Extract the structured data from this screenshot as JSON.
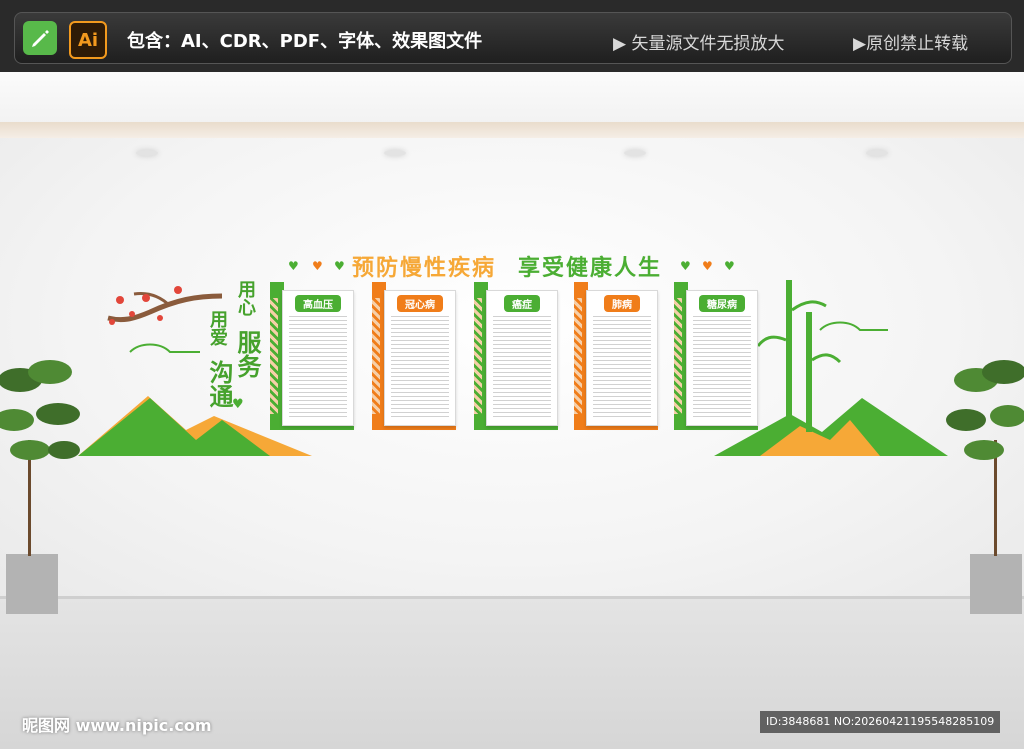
{
  "header": {
    "edit_icon": "pencil-icon",
    "ai_badge": "Ai",
    "contents": "包含：AI、CDR、PDF、字体、效果图文件",
    "feature_1": "▶ 矢量源文件无损放大",
    "feature_2": "▶原创禁止转载"
  },
  "wall": {
    "headline_left": "预防慢性疾病",
    "headline_right": "享受健康人生",
    "slogan_1": "用心",
    "slogan_2": "服务",
    "slogan_3": "用爱",
    "slogan_4": "沟通",
    "panels": [
      {
        "title": "高血压",
        "color": "#4bae33"
      },
      {
        "title": "冠心病",
        "color": "#f07d1a"
      },
      {
        "title": "癌症",
        "color": "#4bae33"
      },
      {
        "title": "肺病",
        "color": "#f07d1a"
      },
      {
        "title": "糖尿病",
        "color": "#4bae33"
      }
    ]
  },
  "footer": {
    "site": "昵图网 www.nipic.com",
    "id": "ID:3848681 NO:20260421195548285109"
  },
  "colors": {
    "green": "#4bae33",
    "orange": "#f07d1a",
    "light_orange": "#f6a837"
  }
}
